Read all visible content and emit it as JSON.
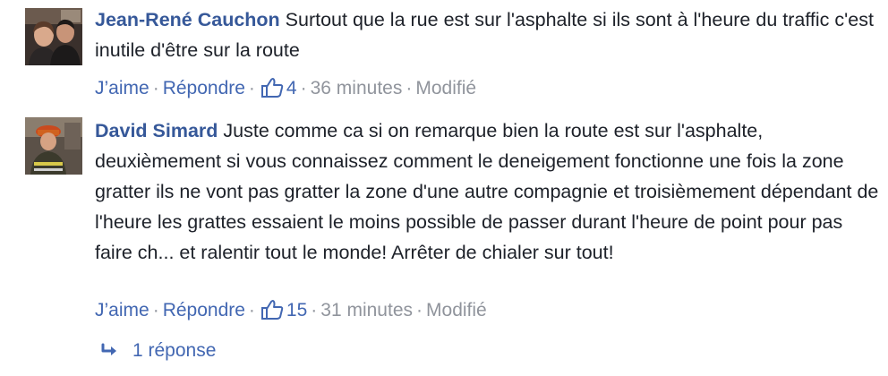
{
  "comments": [
    {
      "author": "Jean-René Cauchon",
      "text": "Surtout que la rue est sur l'asphalte si ils sont à l'heure du traffic c'est inutile d'être sur la route",
      "actions": {
        "like_label": "J’aime",
        "reply_label": "Répondre",
        "like_count": "4",
        "time": "36 minutes",
        "edited": "Modifié"
      }
    },
    {
      "author": "David Simard",
      "text": "Juste comme ca si on remarque bien la route est sur l'asphalte, deuxièmement si vous connaissez comment le deneigement fonctionne une fois la zone gratter ils ne vont pas gratter la zone d'une autre compagnie et troisièmement dépendant de l'heure les grattes essaient le moins possible de passer durant l'heure de point pour pas faire ch... et ralentir tout le monde! Arrêter de chialer sur tout!",
      "actions": {
        "like_label": "J’aime",
        "reply_label": "Répondre",
        "like_count": "15",
        "time": "31 minutes",
        "edited": "Modifié"
      }
    }
  ],
  "replies": {
    "label": "1 réponse"
  },
  "icons": {
    "like": "thumbs-up-icon",
    "reply_arrow": "reply-arrow-icon"
  },
  "colors": {
    "link": "#365899",
    "action_link": "#4267b2",
    "meta": "#90949c",
    "text": "#1d2129"
  }
}
